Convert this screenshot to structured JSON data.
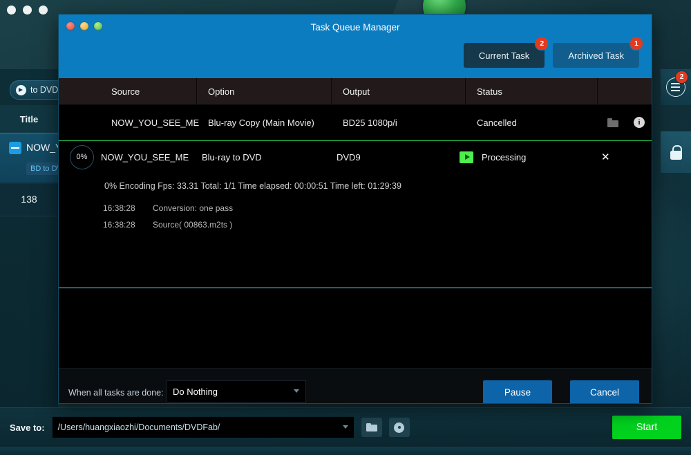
{
  "background_app": {
    "window_controls": [
      "minimize",
      "minimize",
      "minimize"
    ],
    "to_dvd_button": {
      "label": "to DVD",
      "icon": "disc-arrow-icon"
    },
    "title_column_header": "Title",
    "selected_title": {
      "name": "NOW_Y",
      "format_badge": "BD to DV",
      "collapse_icon": "minus-icon"
    },
    "duration_count": "138",
    "rail": {
      "queue_badge": "2",
      "queue_icon": "queue-list-icon",
      "lock_icon": "lock-icon"
    },
    "save_bar": {
      "label": "Save to:",
      "path": "/Users/huangxiaozhi/Documents/DVDFab/",
      "browse_folder_icon": "folder-icon",
      "burn_disc_icon": "disc-icon",
      "start_button": "Start"
    }
  },
  "dialog": {
    "title": "Task Queue Manager",
    "window_controls": {
      "close": "close-button",
      "minimize": "minimize-button",
      "zoom": "zoom-button"
    },
    "tabs": [
      {
        "label": "Current Task",
        "badge": "2"
      },
      {
        "label": "Archived Task",
        "badge": "1"
      }
    ],
    "table": {
      "columns": [
        "Source",
        "Option",
        "Output",
        "Status"
      ],
      "rows": [
        {
          "source": "NOW_YOU_SEE_ME",
          "option": "Blu-ray Copy (Main Movie)",
          "output": "BD25 1080p/i",
          "status": "Cancelled",
          "actions": [
            "open-folder-icon",
            "info-icon"
          ]
        },
        {
          "progress": "0%",
          "source": "NOW_YOU_SEE_ME",
          "option": "Blu-ray to DVD",
          "output": "DVD9",
          "status": "Processing",
          "state_icon": "play-icon",
          "close_label": "✕"
        }
      ]
    },
    "log": {
      "summary": "0%  Encoding Fps: 33.31   Total: 1/1  Time elapsed: 00:00:51  Time left: 01:29:39",
      "entries": [
        {
          "time": "16:38:28",
          "message": "Conversion: one pass"
        },
        {
          "time": "16:38:28",
          "message": "Source( 00863.m2ts )"
        }
      ]
    },
    "footer": {
      "when_done_label": "When all tasks are done:",
      "when_done_value": "Do Nothing",
      "pause_button": "Pause",
      "cancel_button": "Cancel"
    }
  },
  "colors": {
    "dialog_titlebar": "#0b7cc0",
    "accent_button": "#0e64a8",
    "start_green": "#00d21e",
    "badge_red": "#e03b20",
    "processing_green": "#4dee4d",
    "header_row": "#221a1a"
  }
}
